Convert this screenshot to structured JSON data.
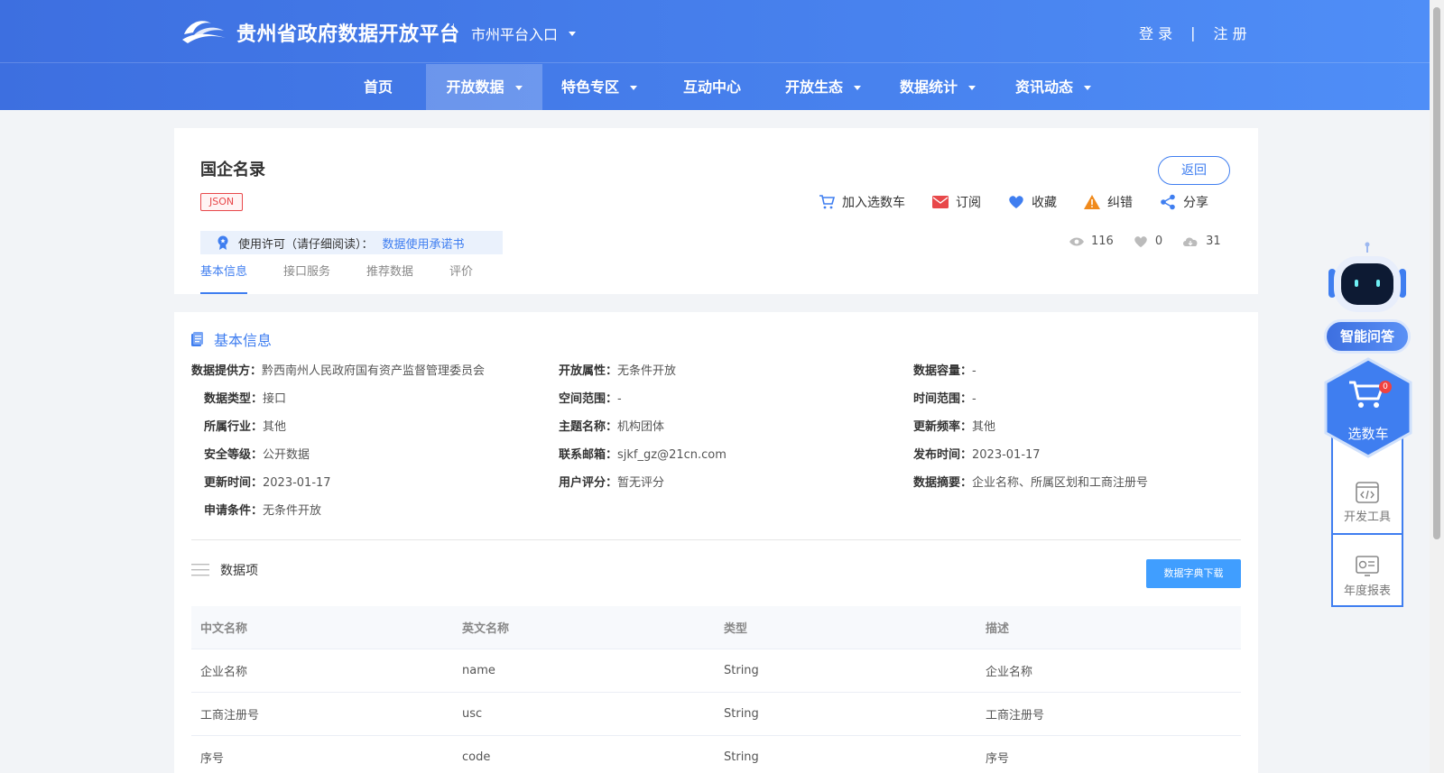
{
  "header": {
    "site_title": "贵州省政府数据开放平台",
    "city_entry": "市州平台入口",
    "login": "登 录",
    "separator": "|",
    "register": "注 册"
  },
  "nav": {
    "items": [
      {
        "label": "首页"
      },
      {
        "label": "开放数据"
      },
      {
        "label": "特色专区"
      },
      {
        "label": "互动中心"
      },
      {
        "label": "开放生态"
      },
      {
        "label": "数据统计"
      },
      {
        "label": "资讯动态"
      }
    ],
    "active_index": 1
  },
  "dataset": {
    "title": "国企名录",
    "format_tag": "JSON",
    "back_label": "返回",
    "actions": {
      "add_cart": "加入选数车",
      "subscribe": "订阅",
      "favorite": "收藏",
      "report": "纠错",
      "share": "分享"
    },
    "license": {
      "label": "使用许可（请仔细阅读）：",
      "link": "数据使用承诺书"
    },
    "stats": {
      "views": "116",
      "likes": "0",
      "downloads": "31"
    },
    "tabs": [
      "基本信息",
      "接口服务",
      "推荐数据",
      "评价"
    ]
  },
  "basic_info": {
    "section_title": "基本信息",
    "fields": {
      "provider_label": "数据提供方：",
      "provider_value": "黔西南州人民政府国有资产监督管理委员会",
      "open_attr_label": "开放属性：",
      "open_attr_value": "无条件开放",
      "capacity_label": "数据容量：",
      "capacity_value": "-",
      "type_label": "数据类型：",
      "type_value": "接口",
      "space_label": "空间范围：",
      "space_value": "-",
      "time_label": "时间范围：",
      "time_value": "-",
      "industry_label": "所属行业：",
      "industry_value": "其他",
      "topic_label": "主题名称：",
      "topic_value": "机构团体",
      "freq_label": "更新频率：",
      "freq_value": "其他",
      "security_label": "安全等级：",
      "security_value": "公开数据",
      "email_label": "联系邮箱：",
      "email_value": "sjkf_gz@21cn.com",
      "publish_label": "发布时间：",
      "publish_value": "2023-01-17",
      "update_label": "更新时间：",
      "update_value": "2023-01-17",
      "rating_label": "用户评分：",
      "rating_value": "暂无评分",
      "summary_label": "数据摘要：",
      "summary_value": "企业名称、所属区划和工商注册号",
      "condition_label": "申请条件：",
      "condition_value": "无条件开放"
    }
  },
  "data_items": {
    "title": "数据项",
    "download_label": "数据字典下载",
    "columns": [
      "中文名称",
      "英文名称",
      "类型",
      "描述"
    ],
    "rows": [
      [
        "企业名称",
        "name",
        "String",
        "企业名称"
      ],
      [
        "工商注册号",
        "usc",
        "String",
        "工商注册号"
      ],
      [
        "序号",
        "code",
        "String",
        "序号"
      ]
    ]
  },
  "widgets": {
    "ai_label": "智能问答",
    "cart_label": "选数车",
    "cart_count": "0",
    "dev_tools": "开发工具",
    "annual_report": "年度报表"
  },
  "colors": {
    "primary": "#3f7ef0",
    "header_start": "#3d6fe0",
    "header_end": "#4f8ef7",
    "tag_red": "#e8484a",
    "button_blue": "#409eff"
  }
}
